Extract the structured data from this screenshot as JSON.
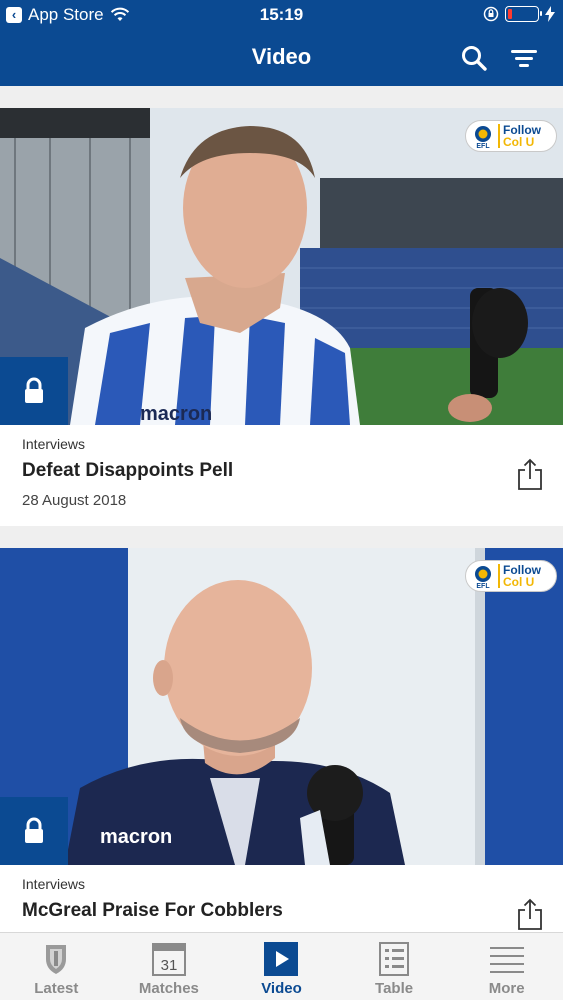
{
  "status_bar": {
    "back_label": "App Store",
    "time": "15:19",
    "battery_level": 0.15
  },
  "nav": {
    "title": "Video",
    "search_icon": "search-icon",
    "filter_icon": "filter-icon"
  },
  "videos": [
    {
      "category": "Interviews",
      "title": "Defeat Disappoints Pell",
      "date": "28 August 2018",
      "locked": true,
      "badge": {
        "efl": "EFL",
        "line1": "Follow",
        "line2": "Col U"
      }
    },
    {
      "category": "Interviews",
      "title": "McGreal Praise For Cobblers",
      "date": "",
      "locked": true,
      "badge": {
        "efl": "EFL",
        "line1": "Follow",
        "line2": "Col U"
      }
    }
  ],
  "tabs": [
    {
      "label": "Latest",
      "icon": "crest-icon"
    },
    {
      "label": "Matches",
      "icon": "calendar-icon",
      "calendar_day": "31"
    },
    {
      "label": "Video",
      "icon": "play-icon",
      "active": true
    },
    {
      "label": "Table",
      "icon": "table-icon"
    },
    {
      "label": "More",
      "icon": "menu-icon"
    }
  ],
  "colors": {
    "brand_blue": "#0b4a92",
    "accent_yellow": "#f2b705",
    "battery_red": "#ff3b30",
    "tab_inactive": "#8a8a8a"
  }
}
